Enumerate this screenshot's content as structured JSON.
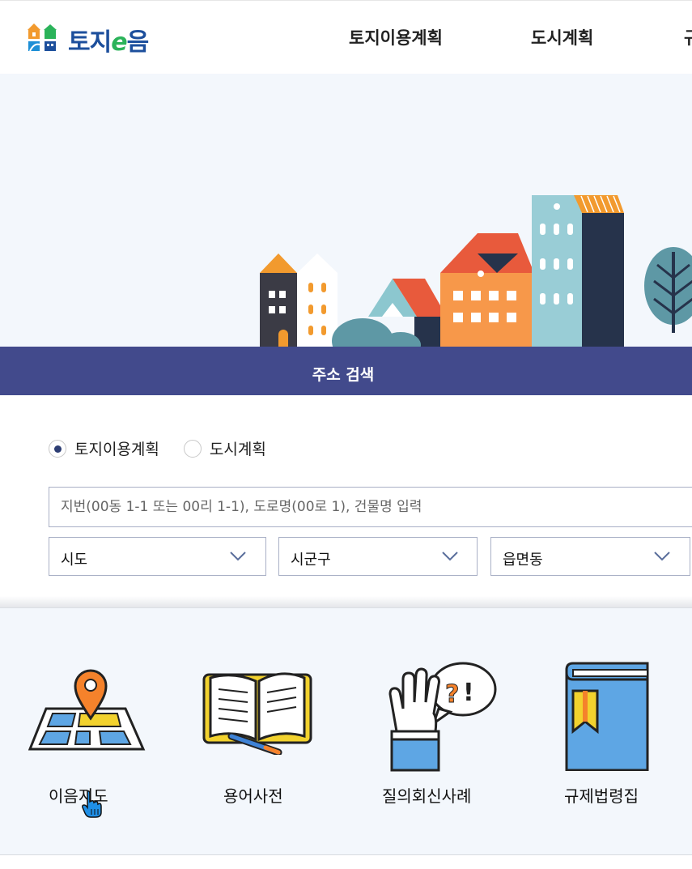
{
  "header": {
    "logo_text_a": "토지",
    "logo_text_e": "e",
    "logo_text_b": "음",
    "nav": [
      "토지이용계획",
      "도시계획",
      "규"
    ]
  },
  "search": {
    "title": "주소 검색",
    "radio": [
      {
        "label": "토지이용계획",
        "checked": true
      },
      {
        "label": "도시계획",
        "checked": false
      }
    ],
    "placeholder": "지번(00동 1-1 또는 00리 1-1), 도로명(00로 1), 건물명 입력",
    "selects": [
      "시도",
      "시군구",
      "읍면동"
    ]
  },
  "quick_menu": [
    "이음지도",
    "용어사전",
    "질의회신사례",
    "규제법령집"
  ],
  "colors": {
    "brand_blue": "#1d4f9c",
    "brand_green": "#2bb35a",
    "search_bar": "#424a8c",
    "hero_bg": "#f3f7fc"
  }
}
